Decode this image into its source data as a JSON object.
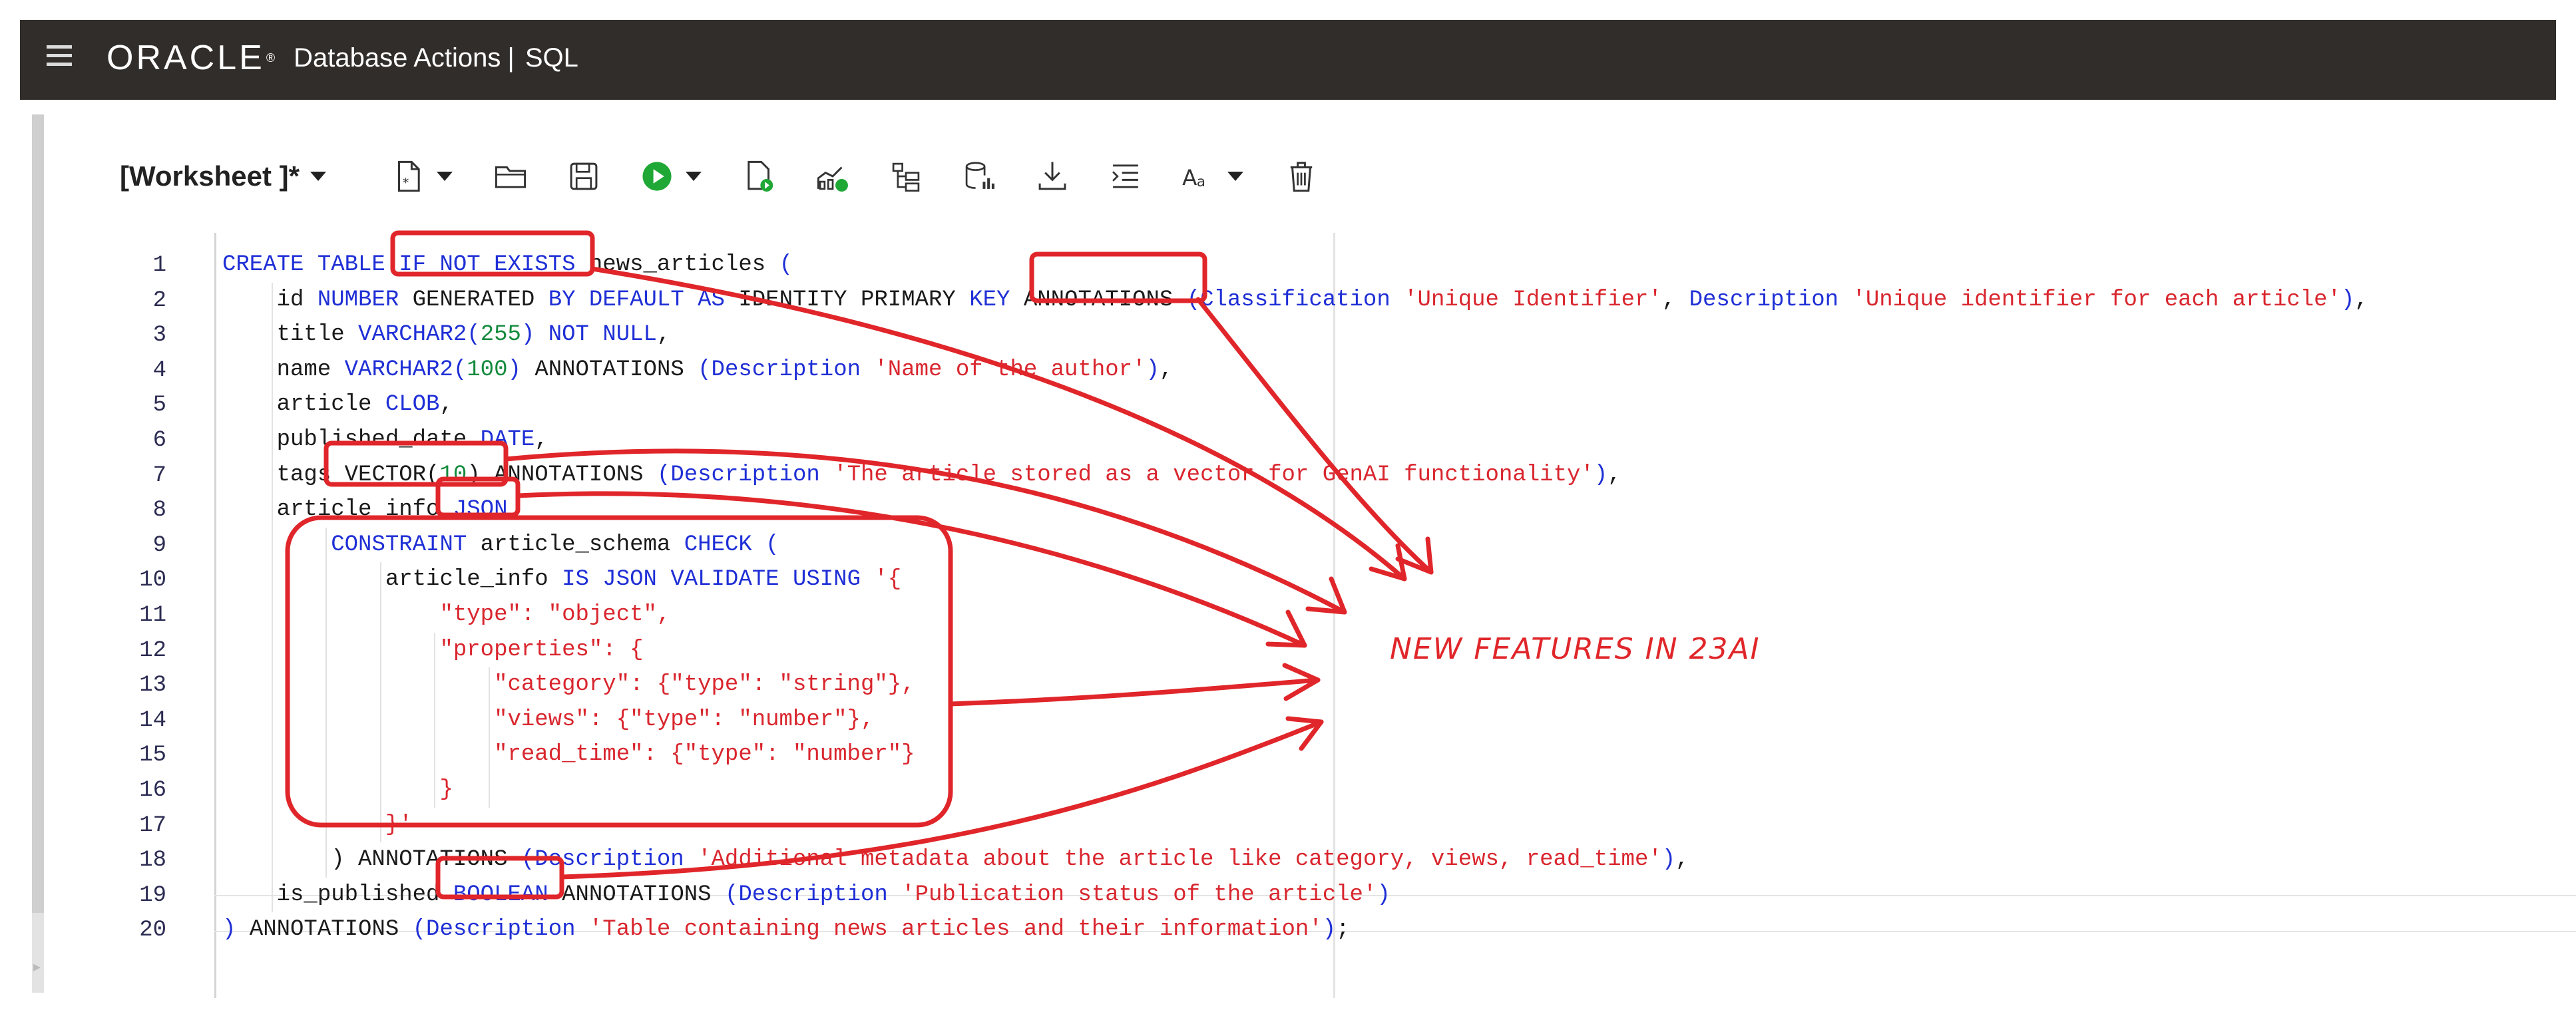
{
  "header": {
    "logo_text": "ORACLE",
    "logo_mark": "®",
    "app_name": "Database Actions",
    "separator": "|",
    "section": "SQL"
  },
  "toolbar": {
    "worksheet_label": "[Worksheet ]*",
    "icons": [
      "new-file-icon",
      "open-folder-icon",
      "save-icon",
      "run-icon",
      "run-script-icon",
      "explain-plan-icon",
      "autotrace-icon",
      "sql-history-icon",
      "download-icon",
      "format-icon",
      "font-size-icon",
      "clear-icon"
    ]
  },
  "editor": {
    "line_numbers": [
      "1",
      "2",
      "3",
      "4",
      "5",
      "6",
      "7",
      "8",
      "9",
      "10",
      "11",
      "12",
      "13",
      "14",
      "15",
      "16",
      "17",
      "18",
      "19",
      "20"
    ],
    "lines": [
      [
        [
          "kw",
          "CREATE TABLE "
        ],
        [
          "kw",
          "IF NOT EXISTS "
        ],
        [
          "plain",
          "news_articles "
        ],
        [
          "kw",
          "("
        ]
      ],
      [
        [
          "plain",
          "    id "
        ],
        [
          "kw",
          "NUMBER "
        ],
        [
          "plain",
          "GENERATED "
        ],
        [
          "kw",
          "BY DEFAULT AS "
        ],
        [
          "plain",
          "IDENTITY PRIMARY "
        ],
        [
          "kw",
          "KEY "
        ],
        [
          "plain",
          "ANNOTATIONS "
        ],
        [
          "kw",
          "(Classification "
        ],
        [
          "str",
          "'Unique Identifier'"
        ],
        [
          "plain",
          ", "
        ],
        [
          "kw",
          "Description "
        ],
        [
          "str",
          "'Unique identifier for each article'"
        ],
        [
          "kw",
          ")"
        ],
        [
          "plain",
          ","
        ]
      ],
      [
        [
          "plain",
          "    title "
        ],
        [
          "kw",
          "VARCHAR2("
        ],
        [
          "num",
          "255"
        ],
        [
          "kw",
          ") NOT NULL"
        ],
        [
          "plain",
          ","
        ]
      ],
      [
        [
          "plain",
          "    name "
        ],
        [
          "kw",
          "VARCHAR2("
        ],
        [
          "num",
          "100"
        ],
        [
          "kw",
          ") "
        ],
        [
          "plain",
          "ANNOTATIONS "
        ],
        [
          "kw",
          "(Description "
        ],
        [
          "str",
          "'Name of the author'"
        ],
        [
          "kw",
          ")"
        ],
        [
          "plain",
          ","
        ]
      ],
      [
        [
          "plain",
          "    article "
        ],
        [
          "kw",
          "CLOB"
        ],
        [
          "plain",
          ","
        ]
      ],
      [
        [
          "plain",
          "    published_date "
        ],
        [
          "kw",
          "DATE"
        ],
        [
          "plain",
          ","
        ]
      ],
      [
        [
          "plain",
          "    tags "
        ],
        [
          "plain",
          "VECTOR("
        ],
        [
          "num",
          "10"
        ],
        [
          "plain",
          ") ANNOTATIONS "
        ],
        [
          "kw",
          "(Description "
        ],
        [
          "str",
          "'The article stored as a vector for GenAI functionality'"
        ],
        [
          "kw",
          ")"
        ],
        [
          "plain",
          ","
        ]
      ],
      [
        [
          "plain",
          "    article_info "
        ],
        [
          "kw",
          "JSON"
        ]
      ],
      [
        [
          "plain",
          "        "
        ],
        [
          "kw",
          "CONSTRAINT "
        ],
        [
          "plain",
          "article_schema "
        ],
        [
          "kw",
          "CHECK ("
        ]
      ],
      [
        [
          "plain",
          "            article_info "
        ],
        [
          "kw",
          "IS JSON VALIDATE USING "
        ],
        [
          "str",
          "'{"
        ]
      ],
      [
        [
          "str",
          "                \"type\": \"object\","
        ]
      ],
      [
        [
          "str",
          "                \"properties\": {"
        ]
      ],
      [
        [
          "str",
          "                    \"category\": {\"type\": \"string\"},"
        ]
      ],
      [
        [
          "str",
          "                    \"views\": {\"type\": \"number\"},"
        ]
      ],
      [
        [
          "str",
          "                    \"read_time\": {\"type\": \"number\"}"
        ]
      ],
      [
        [
          "str",
          "                }"
        ]
      ],
      [
        [
          "str",
          "            }'"
        ]
      ],
      [
        [
          "plain",
          "        ) ANNOTATIONS "
        ],
        [
          "kw",
          "(Description "
        ],
        [
          "str",
          "'Additional metadata about the article like category, views, read_time'"
        ],
        [
          "kw",
          ")"
        ],
        [
          "plain",
          ","
        ]
      ],
      [
        [
          "plain",
          "    is_published "
        ],
        [
          "kw",
          "BOOLEAN "
        ],
        [
          "plain",
          "ANNOTATIONS "
        ],
        [
          "kw",
          "(Description "
        ],
        [
          "str",
          "'Publication status of the article'"
        ],
        [
          "kw",
          ")"
        ]
      ],
      [
        [
          "kw",
          ") "
        ],
        [
          "plain",
          "ANNOTATIONS "
        ],
        [
          "kw",
          "(Description "
        ],
        [
          "str",
          "'Table containing news articles and their information'"
        ],
        [
          "kw",
          ")"
        ],
        [
          "plain",
          ";"
        ]
      ]
    ]
  },
  "annotation": {
    "label": "NEW FEATURES IN 23AI",
    "color": "#e0262a"
  },
  "colors": {
    "header_bg": "#312d2a",
    "keyword": "#1f2fd6",
    "string": "#d9262e",
    "number": "#138a3c",
    "run_button": "#1fa836"
  }
}
